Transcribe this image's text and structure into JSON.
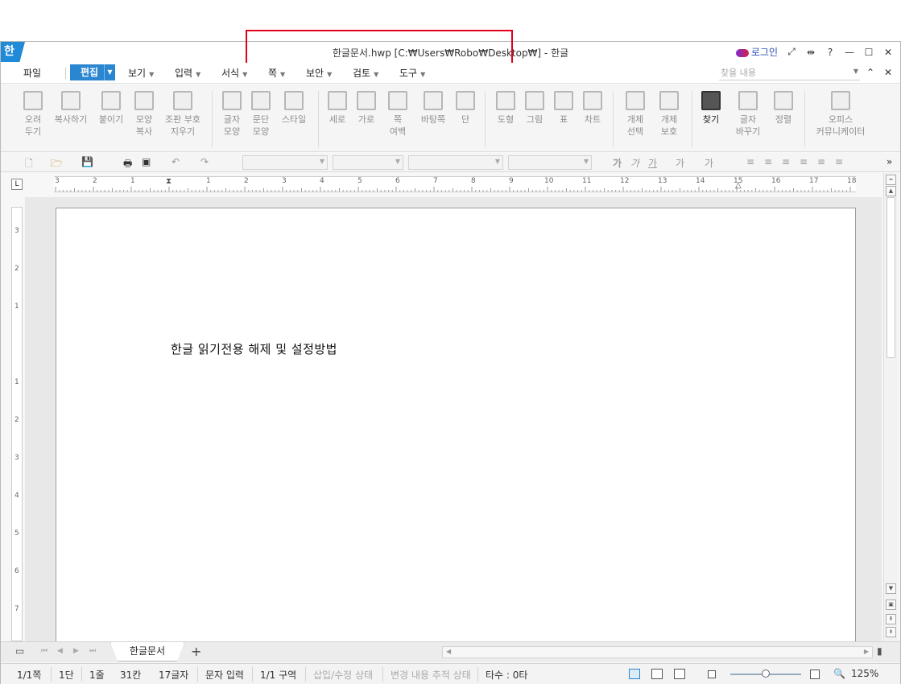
{
  "window": {
    "app_logo": "한",
    "title": "한글문서.hwp [C:₩Users₩Robo₩Desktop₩] - 한글",
    "login_label": "로그인",
    "controls": [
      "⤢",
      "⇹",
      "?",
      "—",
      "☐",
      "✕"
    ]
  },
  "menu": {
    "file": "파일",
    "active": "편집",
    "items": [
      "보기",
      "입력",
      "서식",
      "쪽",
      "보안",
      "검토",
      "도구"
    ],
    "search_placeholder": "찾을 내용"
  },
  "ribbon": {
    "buttons": [
      {
        "label": "오려\n두기"
      },
      {
        "label": "복사하기"
      },
      {
        "label": "붙이기"
      },
      {
        "label": "모양\n복사"
      },
      {
        "label": "조판 부호\n지우기"
      },
      {
        "label": "글자\n모양"
      },
      {
        "label": "문단\n모양"
      },
      {
        "label": "스타일"
      },
      {
        "label": "세로"
      },
      {
        "label": "가로"
      },
      {
        "label": "쪽\n여백"
      },
      {
        "label": "바탕쪽"
      },
      {
        "label": "단"
      },
      {
        "label": "도형"
      },
      {
        "label": "그림"
      },
      {
        "label": "표"
      },
      {
        "label": "차트"
      },
      {
        "label": "개체\n선택"
      },
      {
        "label": "개체\n보호"
      },
      {
        "label": "찾기"
      },
      {
        "label": "글자\n바꾸기"
      },
      {
        "label": "정렬"
      },
      {
        "label": "오피스\n커뮤니케이터"
      }
    ]
  },
  "ruler": {
    "h_ticks": [
      "3",
      "2",
      "1",
      "",
      "1",
      "2",
      "3",
      "4",
      "5",
      "6",
      "7",
      "8",
      "9",
      "10",
      "11",
      "12",
      "13",
      "14",
      "15",
      "16",
      "17",
      "18"
    ],
    "v_ticks": [
      "3",
      "2",
      "1",
      "",
      "1",
      "2",
      "3",
      "4",
      "5",
      "6",
      "7"
    ]
  },
  "document": {
    "body_text": "한글 읽기전용 해제 및 설정방법"
  },
  "tabs": {
    "sheet_name": "한글문서",
    "add": "+"
  },
  "status": {
    "page": "1/1쪽",
    "column": "1단",
    "line": "1줄",
    "col_pos": "31칸",
    "chars": "17글자",
    "mode": "문자 입력",
    "section": "1/1 구역",
    "insert_state": "삽입/수정 상태",
    "track_state": "변경 내용 추적 상태",
    "typing": "타수 : 0타",
    "zoom": "125%"
  },
  "colors": {
    "accent": "#2b86d1",
    "highlight_box": "#e1001a"
  }
}
